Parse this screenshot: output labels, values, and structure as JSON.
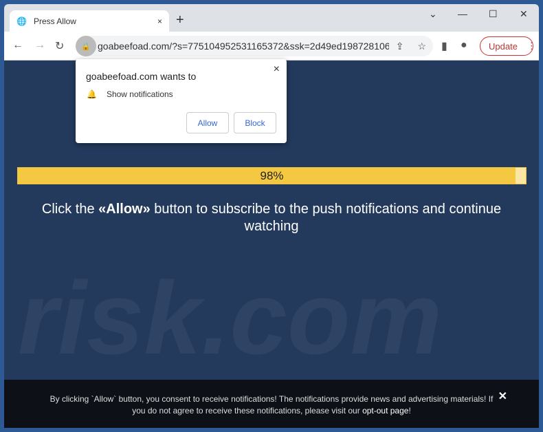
{
  "tab": {
    "title": "Press Allow",
    "close": "×",
    "new": "+"
  },
  "window": {
    "dropdown": "⌄",
    "minimize": "—",
    "maximize": "☐",
    "close": "✕"
  },
  "toolbar": {
    "back": "←",
    "forward": "→",
    "reload": "↻",
    "url": "goabeefoad.com/?s=775104952531165372&ssk=2d49ed198728106...",
    "update_label": "Update",
    "menu": "⋮"
  },
  "popup": {
    "title": "goabeefoad.com wants to",
    "permission": "Show notifications",
    "allow": "Allow",
    "block": "Block",
    "close": "×"
  },
  "progress": {
    "value": 98,
    "label": "98%",
    "colors": {
      "fill": "#f5c842",
      "track": "#fbe6a3"
    }
  },
  "message": {
    "before": "Click the ",
    "bold": "«Allow»",
    "after": " button to subscribe to the push notifications and continue watching"
  },
  "watermark": "risk.com",
  "footer": {
    "text": "By clicking `Allow` button, you consent to receive notifications! The notifications provide news and advertising materials! If you do not agree to receive these notifications, please visit our ",
    "link": "opt-out page",
    "end": "!",
    "close": "✕"
  }
}
